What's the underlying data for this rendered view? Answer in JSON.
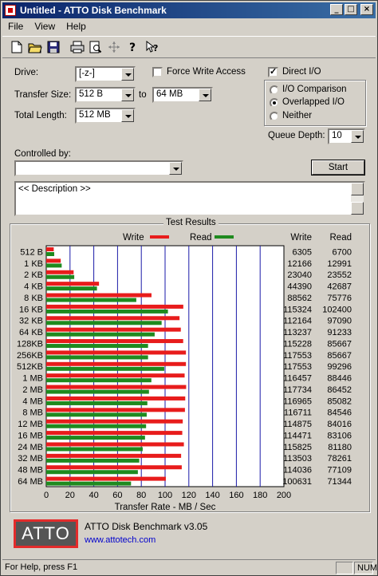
{
  "window": {
    "title": "Untitled - ATTO Disk Benchmark",
    "controls": {
      "minimize": "_",
      "maximize": "□",
      "close": "×"
    }
  },
  "menu": [
    "File",
    "View",
    "Help"
  ],
  "toolbar": {
    "icons": [
      "new-file-icon",
      "open-folder-icon",
      "save-icon",
      "print-icon",
      "print-preview-icon",
      "move-icon",
      "help-icon",
      "context-help-icon"
    ]
  },
  "settings": {
    "drive_label": "Drive:",
    "drive_value": "[-z-]",
    "force_write_label": "Force Write Access",
    "force_write_checked": false,
    "direct_io_label": "Direct I/O",
    "direct_io_checked": true,
    "transfer_size_label": "Transfer Size:",
    "transfer_from": "512 B",
    "to_label": "to",
    "transfer_to": "64 MB",
    "total_length_label": "Total Length:",
    "total_length": "512 MB",
    "io_options": [
      {
        "label": "I/O Comparison",
        "selected": false
      },
      {
        "label": "Overlapped I/O",
        "selected": true
      },
      {
        "label": "Neither",
        "selected": false
      }
    ],
    "queue_depth_label": "Queue Depth:",
    "queue_depth": "10",
    "controlled_by_label": "Controlled by:",
    "controlled_by_value": "",
    "start_button": "Start",
    "description": "<< Description >>"
  },
  "results": {
    "group_label": "Test Results",
    "legend_write": "Write",
    "legend_read": "Read",
    "col_write": "Write",
    "col_read": "Read"
  },
  "chart_data": {
    "type": "bar",
    "orientation": "horizontal",
    "xlabel": "Transfer Rate - MB / Sec",
    "xlim": [
      0,
      200
    ],
    "xticks": [
      0,
      20,
      40,
      60,
      80,
      100,
      120,
      140,
      160,
      180,
      200
    ],
    "grid": true,
    "legend": "top",
    "colors": {
      "write": "#e81c1c",
      "read": "#1f8a1f"
    },
    "categories": [
      "512 B",
      "1 KB",
      "2 KB",
      "4 KB",
      "8 KB",
      "16 KB",
      "32 KB",
      "64 KB",
      "128KB",
      "256KB",
      "512KB",
      "1 MB",
      "2 MB",
      "4 MB",
      "8 MB",
      "12 MB",
      "16 MB",
      "24 MB",
      "32 MB",
      "48 MB",
      "64 MB"
    ],
    "series": [
      {
        "name": "Write",
        "values": [
          6305,
          12166,
          23040,
          44390,
          88562,
          115324,
          112164,
          113237,
          115228,
          117553,
          117553,
          116457,
          117734,
          116965,
          116711,
          114875,
          114471,
          115825,
          113503,
          114036,
          100631
        ]
      },
      {
        "name": "Read",
        "values": [
          6700,
          12991,
          23552,
          42687,
          75776,
          102400,
          97090,
          91233,
          85667,
          85667,
          99296,
          88446,
          86452,
          85082,
          84546,
          84016,
          83106,
          81180,
          78261,
          77109,
          71344
        ]
      }
    ]
  },
  "about": {
    "logo_text": "ATTO",
    "product": "ATTO Disk Benchmark v3.05",
    "link": "www.attotech.com"
  },
  "status": {
    "help_text": "For Help, press F1",
    "num_indicator": "NUM"
  }
}
